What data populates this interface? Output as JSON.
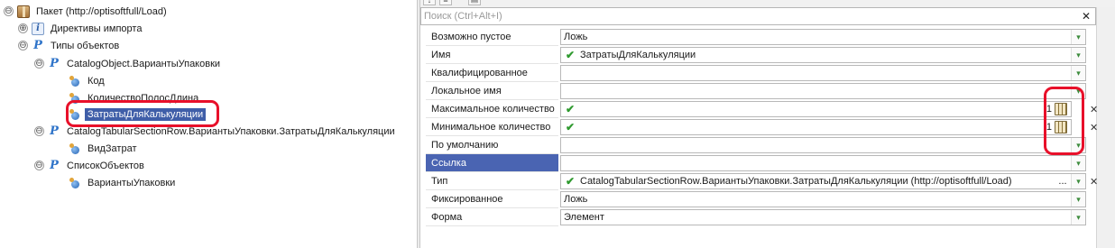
{
  "tree": {
    "root": {
      "label": "Пакет (http://optisoftfull/Load)",
      "toggle": "⊖"
    },
    "import_directives": {
      "label": "Директивы импорта",
      "toggle": "⊕"
    },
    "object_types": {
      "label": "Типы объектов",
      "toggle": "⊖"
    },
    "catalog_object": {
      "label": "CatalogObject.ВариантыУпаковки",
      "toggle": "⊖"
    },
    "prop_code": {
      "label": "Код"
    },
    "prop_strip_count": {
      "label": "КоличествоПолосДлина"
    },
    "prop_costs": {
      "label": "ЗатратыДляКалькуляции"
    },
    "tabular_section_row": {
      "label": "CatalogTabularSectionRow.ВариантыУпаковки.ЗатратыДляКалькуляции",
      "toggle": "⊖"
    },
    "prop_cost_type": {
      "label": "ВидЗатрат"
    },
    "object_list": {
      "label": "СписокОбъектов",
      "toggle": "⊖"
    },
    "prop_packaging_options": {
      "label": "ВариантыУпаковки"
    }
  },
  "panel": {
    "search": {
      "placeholder": "Поиск (Ctrl+Alt+I)",
      "value": ""
    },
    "clear_glyph": "✕",
    "properties": [
      {
        "label": "Возможно пустое",
        "value": "Ложь",
        "check": "",
        "number": ""
      },
      {
        "label": "Имя",
        "value": "ЗатратыДляКалькуляции",
        "check": "✔",
        "number": ""
      },
      {
        "label": "Квалифицированное",
        "value": "",
        "check": "",
        "number": ""
      },
      {
        "label": "Локальное имя",
        "value": "",
        "check": "",
        "number": ""
      },
      {
        "label": "Максимальное количество",
        "value": "",
        "check": "✔",
        "number": "1"
      },
      {
        "label": "Минимальное количество",
        "value": "",
        "check": "✔",
        "number": "1"
      },
      {
        "label": "По умолчанию",
        "value": "",
        "check": "",
        "number": ""
      },
      {
        "label": "Ссылка",
        "value": "",
        "check": "",
        "number": ""
      },
      {
        "label": "Тип",
        "value": "CatalogTabularSectionRow.ВариантыУпаковки.ЗатратыДляКалькуляции (http://optisoftfull/Load)",
        "check": "✔",
        "number": ""
      },
      {
        "label": "Фиксированное",
        "value": "Ложь",
        "check": "",
        "number": ""
      },
      {
        "label": "Форма",
        "value": "Элемент",
        "check": "",
        "number": ""
      }
    ],
    "dropdown_glyph": "▾",
    "clear_field_glyph": "✕",
    "choose_glyph": "...",
    "colors": {
      "selection": "#4a64b2",
      "highlight_ring": "#e8102a",
      "check": "#2f9a2f"
    }
  }
}
